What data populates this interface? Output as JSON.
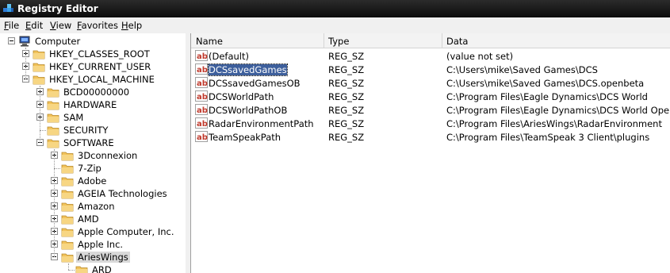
{
  "window": {
    "title": "Registry Editor"
  },
  "menu": [
    "File",
    "Edit",
    "View",
    "Favorites",
    "Help"
  ],
  "tree": [
    {
      "label": "Computer",
      "level": 0,
      "expander": "minus",
      "icon": "computer-icon"
    },
    {
      "label": "HKEY_CLASSES_ROOT",
      "level": 1,
      "expander": "plus",
      "icon": "folder-icon"
    },
    {
      "label": "HKEY_CURRENT_USER",
      "level": 1,
      "expander": "plus",
      "icon": "folder-icon"
    },
    {
      "label": "HKEY_LOCAL_MACHINE",
      "level": 1,
      "expander": "minus",
      "icon": "folder-icon"
    },
    {
      "label": "BCD00000000",
      "level": 2,
      "expander": "plus",
      "icon": "folder-icon"
    },
    {
      "label": "HARDWARE",
      "level": 2,
      "expander": "plus",
      "icon": "folder-icon"
    },
    {
      "label": "SAM",
      "level": 2,
      "expander": "plus",
      "icon": "folder-icon"
    },
    {
      "label": "SECURITY",
      "level": 2,
      "expander": "none",
      "icon": "folder-icon"
    },
    {
      "label": "SOFTWARE",
      "level": 2,
      "expander": "minus",
      "icon": "folder-icon"
    },
    {
      "label": "3Dconnexion",
      "level": 3,
      "expander": "plus",
      "icon": "folder-icon"
    },
    {
      "label": "7-Zip",
      "level": 3,
      "expander": "none",
      "icon": "folder-icon"
    },
    {
      "label": "Adobe",
      "level": 3,
      "expander": "plus",
      "icon": "folder-icon"
    },
    {
      "label": "AGEIA Technologies",
      "level": 3,
      "expander": "plus",
      "icon": "folder-icon"
    },
    {
      "label": "Amazon",
      "level": 3,
      "expander": "plus",
      "icon": "folder-icon"
    },
    {
      "label": "AMD",
      "level": 3,
      "expander": "plus",
      "icon": "folder-icon"
    },
    {
      "label": "Apple Computer, Inc.",
      "level": 3,
      "expander": "plus",
      "icon": "folder-icon"
    },
    {
      "label": "Apple Inc.",
      "level": 3,
      "expander": "plus",
      "icon": "folder-icon"
    },
    {
      "label": "AriesWings",
      "level": 3,
      "expander": "minus",
      "icon": "folder-open-icon",
      "selected": true
    },
    {
      "label": "ARD",
      "level": 4,
      "expander": "none",
      "icon": "folder-icon"
    }
  ],
  "columns": [
    "Name",
    "Type",
    "Data"
  ],
  "values": [
    {
      "name": "(Default)",
      "type": "REG_SZ",
      "data": "(value not set)"
    },
    {
      "name": "DCSsavedGames",
      "type": "REG_SZ",
      "data": "C:\\Users\\mike\\Saved Games\\DCS",
      "selected": true
    },
    {
      "name": "DCSsavedGamesOB",
      "type": "REG_SZ",
      "data": "C:\\Users\\mike\\Saved Games\\DCS.openbeta"
    },
    {
      "name": "DCSWorldPath",
      "type": "REG_SZ",
      "data": "C:\\Program Files\\Eagle Dynamics\\DCS World"
    },
    {
      "name": "DCSWorldPathOB",
      "type": "REG_SZ",
      "data": "C:\\Program Files\\Eagle Dynamics\\DCS World OpenBeta"
    },
    {
      "name": "RadarEnvironmentPath",
      "type": "REG_SZ",
      "data": "C:\\Program Files\\AriesWings\\RadarEnvironment"
    },
    {
      "name": "TeamSpeakPath",
      "type": "REG_SZ",
      "data": "C:\\Program Files\\TeamSpeak 3 Client\\plugins"
    }
  ],
  "colors": {
    "folder": "#f2c35b",
    "selection": "#3d5f9c",
    "titlebar": "#1a1a1a"
  }
}
